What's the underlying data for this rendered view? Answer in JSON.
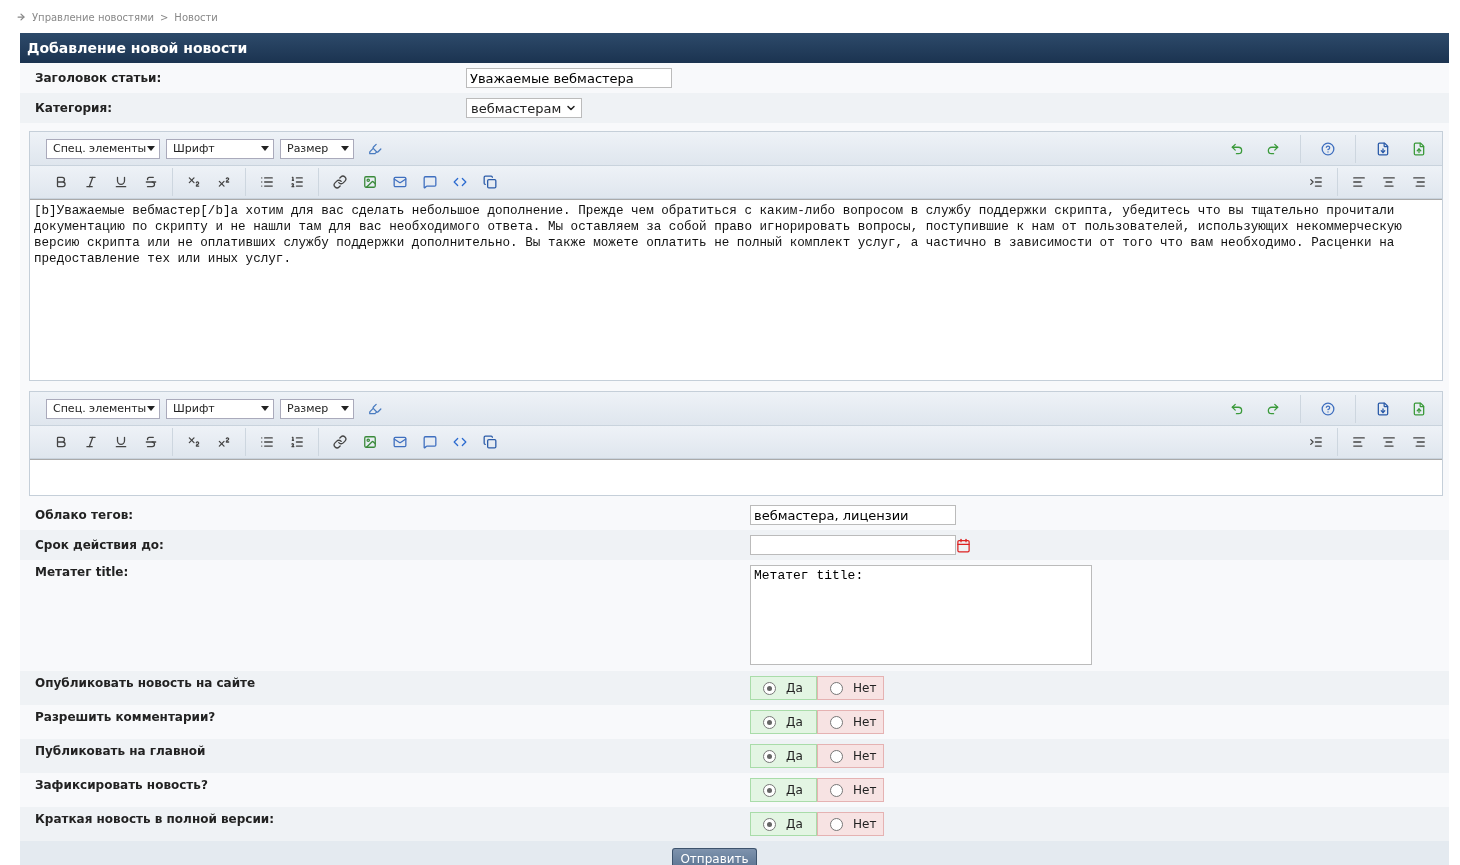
{
  "breadcrumb": [
    "Управление новостями",
    "Новости"
  ],
  "breadcrumb_separator": ">",
  "form_title": "Добавление новой новости",
  "top_fields": [
    {
      "kind": "text",
      "label": "Заголовок статьи:",
      "value": "Уважаемые вебмастера"
    },
    {
      "kind": "select",
      "label": "Категория:",
      "value": "вебмастерам"
    }
  ],
  "editors": [
    {
      "toolbar": [
        "Спец. элементы",
        "Шрифт",
        "Размер"
      ],
      "content": "[b]Уважаемые вебмастер[/b]а хотим для вас сделать небольшое дополнение. Прежде чем обратиться с каким-либо вопросом в службу поддержки скрипта, убедитесь что вы тщательно прочитали документацию по скрипту и не нашли там для вас необходимого ответа. Мы оставляем за собой право игнорировать вопросы, поступившие к нам от пользователей, использующих некоммерческую версию скрипта или не оплативших службу поддержки дополнительно. Вы также можете оплатить не полный комплект услуг, а частично в зависимости от того что вам необходимо. Расценки на предоставление тех или иных услуг."
    },
    {
      "toolbar": [
        "Спец. элементы",
        "Шрифт",
        "Размер"
      ]
    }
  ],
  "bottom_fields": [
    {
      "kind": "text",
      "label": "Облако тегов:",
      "value": "вебмастера, лицензии"
    },
    {
      "kind": "date",
      "label": "Срок действия до:"
    },
    {
      "kind": "textarea",
      "label": "Метатег title:",
      "value": "Метатег title:"
    }
  ],
  "options": [
    {
      "label": "Опубликовать новость на сайте",
      "choices": [
        {
          "label": "Да",
          "selected": true
        },
        {
          "label": "Нет",
          "selected": false
        }
      ]
    },
    {
      "label": "Разрешить комментарии?",
      "choices": [
        {
          "label": "Да",
          "selected": true
        },
        {
          "label": "Нет",
          "selected": false
        }
      ]
    },
    {
      "label": "Публиковать на главной",
      "choices": [
        {
          "label": "Да",
          "selected": true
        },
        {
          "label": "Нет",
          "selected": false
        }
      ]
    },
    {
      "label": "Зафиксировать новость?",
      "choices": [
        {
          "label": "Да",
          "selected": true
        },
        {
          "label": "Нет",
          "selected": false
        }
      ]
    },
    {
      "label": "Краткая новость в полной версии:",
      "choices": [
        {
          "label": "Да",
          "selected": true
        },
        {
          "label": "Нет",
          "selected": false
        }
      ]
    }
  ],
  "submit": "Отправить"
}
